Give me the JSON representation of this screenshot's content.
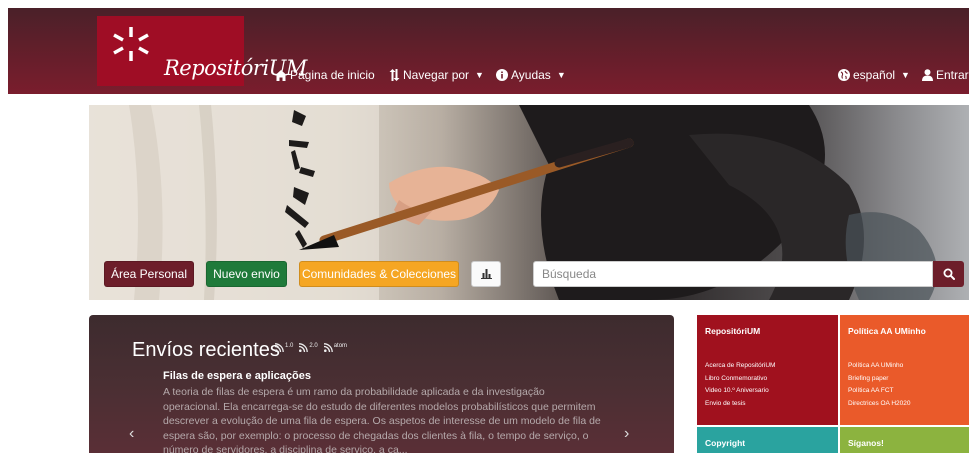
{
  "navbar": {
    "logo_text": "RepositóriUM",
    "home": "Página de inicio",
    "browse": "Navegar por",
    "help": "Ayudas",
    "language": "español",
    "login": "Entrar"
  },
  "hero": {
    "btn_personal": "Área Personal",
    "btn_nuevo": "Nuevo envio",
    "btn_comunidades": "Comunidades & Colecciones",
    "search_placeholder": "Búsqueda"
  },
  "recent": {
    "title": "Envíos recientes",
    "feeds": [
      "1.0",
      "2.0",
      "atom"
    ],
    "item_title": "Filas de espera e aplicações",
    "item_abstract": "A teoria de filas de espera é um ramo da probabilidade aplicada e da investigação operacional. Ela encarrega-se do estudo de diferentes modelos probabilísticos que permitem descrever a evolução de uma fila de espera. Os aspetos de interesse de um modelo de fila de espera são, por exemplo: o processo de chegadas dos clientes à fila, o tempo de serviço, o número de servidores, a disciplina de serviço, a ca...",
    "prev": "‹",
    "next": "›"
  },
  "tiles": {
    "repo": {
      "heading": "RepositóriUM",
      "links": [
        "Acerca de RepositóriUM",
        "Libro Conmemorativo",
        "Video 10.º Aniversario",
        "Envio de tesis"
      ]
    },
    "politica": {
      "heading": "Política AA UMinho",
      "links": [
        "Política AA UMinho",
        "Briefing paper",
        "Política AA FCT",
        "Directrices OA H2020"
      ]
    },
    "copyright": {
      "heading": "Copyright"
    },
    "siganos": {
      "heading": "Síganos!"
    }
  },
  "colors": {
    "brand": "#9f0d25",
    "navbar": "#6e1e2b",
    "nuevo": "#1f7a3a",
    "comunidades": "#f5a623",
    "tile_orange": "#ea5a2a",
    "tile_teal": "#2aa39f",
    "tile_green": "#8cb33f"
  }
}
